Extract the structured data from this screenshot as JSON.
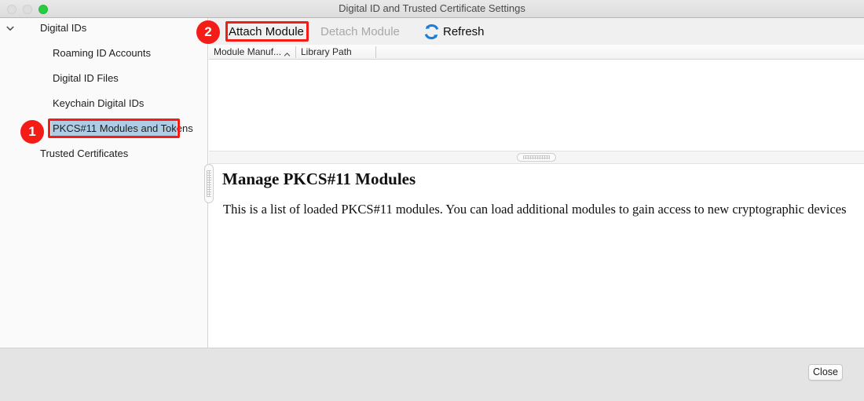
{
  "window": {
    "title": "Digital ID and Trusted Certificate Settings",
    "traffic_lights": {
      "close": "close-button",
      "minimize": "minimize-button",
      "zoom": "zoom-button"
    }
  },
  "sidebar": {
    "root": {
      "label": "Digital IDs",
      "expanded": true,
      "chevron": "chevron-down-icon"
    },
    "items": [
      {
        "label": "Roaming ID Accounts",
        "selected": false
      },
      {
        "label": "Digital ID Files",
        "selected": false
      },
      {
        "label": "Keychain Digital IDs",
        "selected": false
      },
      {
        "label": "PKCS#11 Modules and Tokens",
        "selected": true
      },
      {
        "label": "Trusted Certificates",
        "selected": false
      }
    ],
    "selection_color": "#aecde4"
  },
  "toolbar": {
    "attach_label": "Attach Module",
    "detach_label": "Detach Module",
    "detach_enabled": false,
    "refresh_label": "Refresh",
    "refresh_icon": "refresh-icon",
    "refresh_icon_color": "#1d7ed8"
  },
  "table": {
    "columns": [
      {
        "label": "Module Manuf...",
        "sorted": true,
        "sort_direction": "ascending",
        "sort_icon": "chevron-up-icon"
      },
      {
        "label": "Library Path",
        "sorted": false
      }
    ],
    "rows": []
  },
  "detail": {
    "heading": "Manage PKCS#11 Modules",
    "body": "This is a list of loaded PKCS#11 modules. You can load additional modules to gain access to new cryptographic devices"
  },
  "splitters": {
    "horizontal_grabber": "horizontal-splitter-grabber",
    "vertical_grabber": "vertical-splitter-grabber"
  },
  "footer": {
    "close_label": "Close"
  },
  "annotations": [
    {
      "number": "1",
      "target": "PKCS#11 Modules and Tokens",
      "color": "#f41c16"
    },
    {
      "number": "2",
      "target": "Attach Module",
      "color": "#f41c16"
    }
  ]
}
